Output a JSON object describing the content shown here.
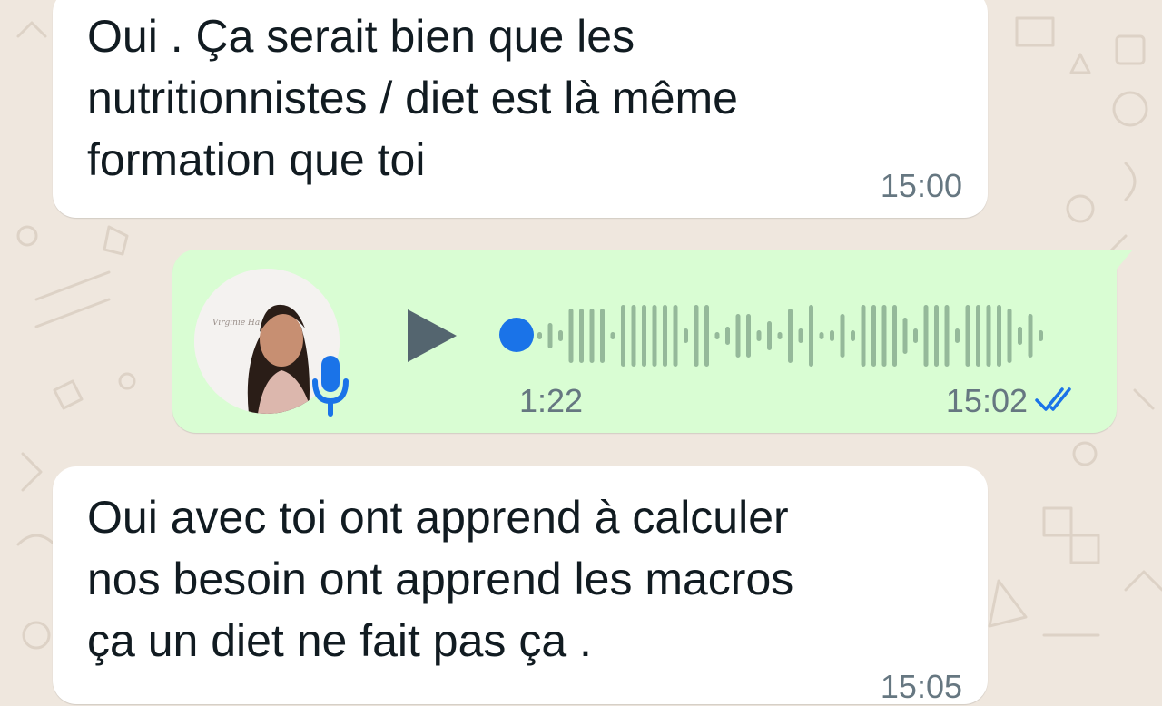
{
  "messages": [
    {
      "direction": "incoming",
      "text": "Oui . Ça serait bien que les\nnutritionnistes / diet est là même\nformation que toi",
      "time": "15:00"
    },
    {
      "direction": "outgoing",
      "type": "voice",
      "duration": "1:22",
      "time": "15:02",
      "status_icon": "double-check-icon",
      "read": true,
      "avatar_signature": "Virginie Ha"
    },
    {
      "direction": "incoming",
      "text": "Oui avec toi ont apprend à calculer\nnos besoin ont apprend les macros\nça un diet ne fait pas ça .",
      "time": "15:05"
    }
  ],
  "colors": {
    "wallpaper": "#efe7de",
    "incoming_bubble": "#ffffff",
    "outgoing_bubble": "#d9fdd3",
    "accent_blue": "#1a73e8",
    "timestamp": "#667781",
    "play_icon": "#54656f"
  }
}
